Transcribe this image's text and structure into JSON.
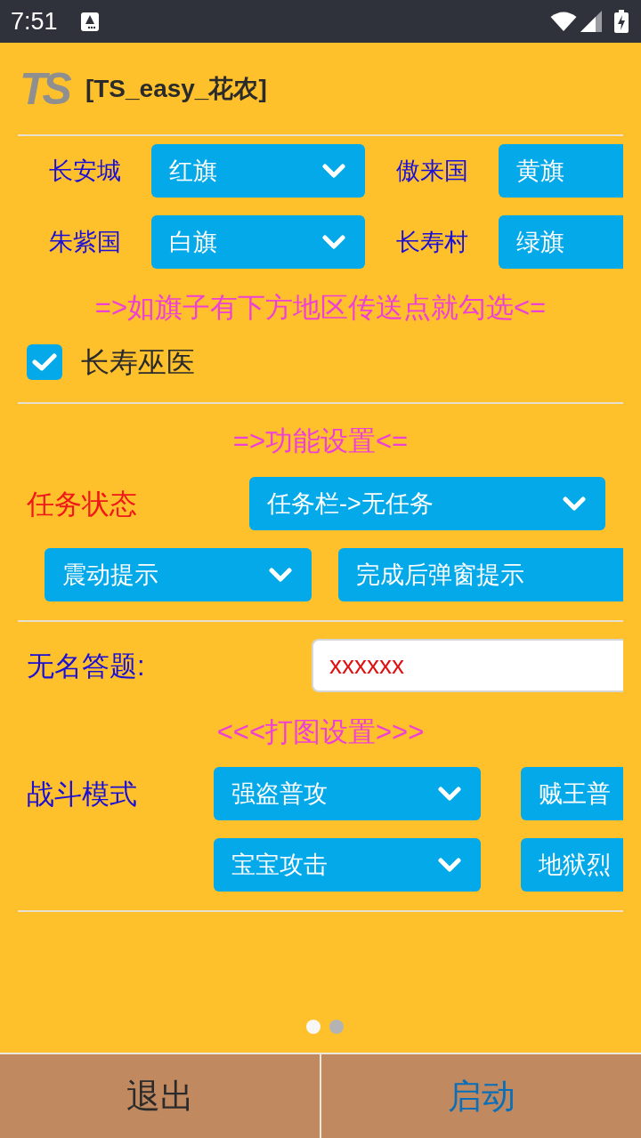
{
  "status_bar": {
    "time": "7:51"
  },
  "header": {
    "logo": "TS",
    "title": "[TS_easy_花农]"
  },
  "flags": [
    {
      "label": "长安城",
      "value": "红旗"
    },
    {
      "label": "傲来国",
      "value": "黄旗"
    },
    {
      "label": "朱紫国",
      "value": "白旗"
    },
    {
      "label": "长寿村",
      "value": "绿旗"
    }
  ],
  "teleport_hint": "=>如旗子有下方地区传送点就勾选<=",
  "teleport_options": [
    {
      "label": "长寿巫医",
      "checked": true
    }
  ],
  "function_settings": {
    "heading": "=>功能设置<=",
    "task_status": {
      "label": "任务状态",
      "value": "任务栏->无任务"
    },
    "options": [
      "震动提示",
      "完成后弹窗提示"
    ]
  },
  "quiz": {
    "label": "无名答题:",
    "value": "xxxxxx"
  },
  "combat_settings": {
    "heading": "<<<打图设置>>>",
    "label": "战斗模式",
    "options": [
      "强盗普攻",
      "贼王普",
      "宝宝攻击",
      "地狱烈"
    ]
  },
  "pager": [
    {
      "selected": true
    },
    {
      "selected": false
    }
  ],
  "buttons": [
    {
      "label": "退出",
      "kind": "exit"
    },
    {
      "label": "启动",
      "kind": "start"
    }
  ]
}
